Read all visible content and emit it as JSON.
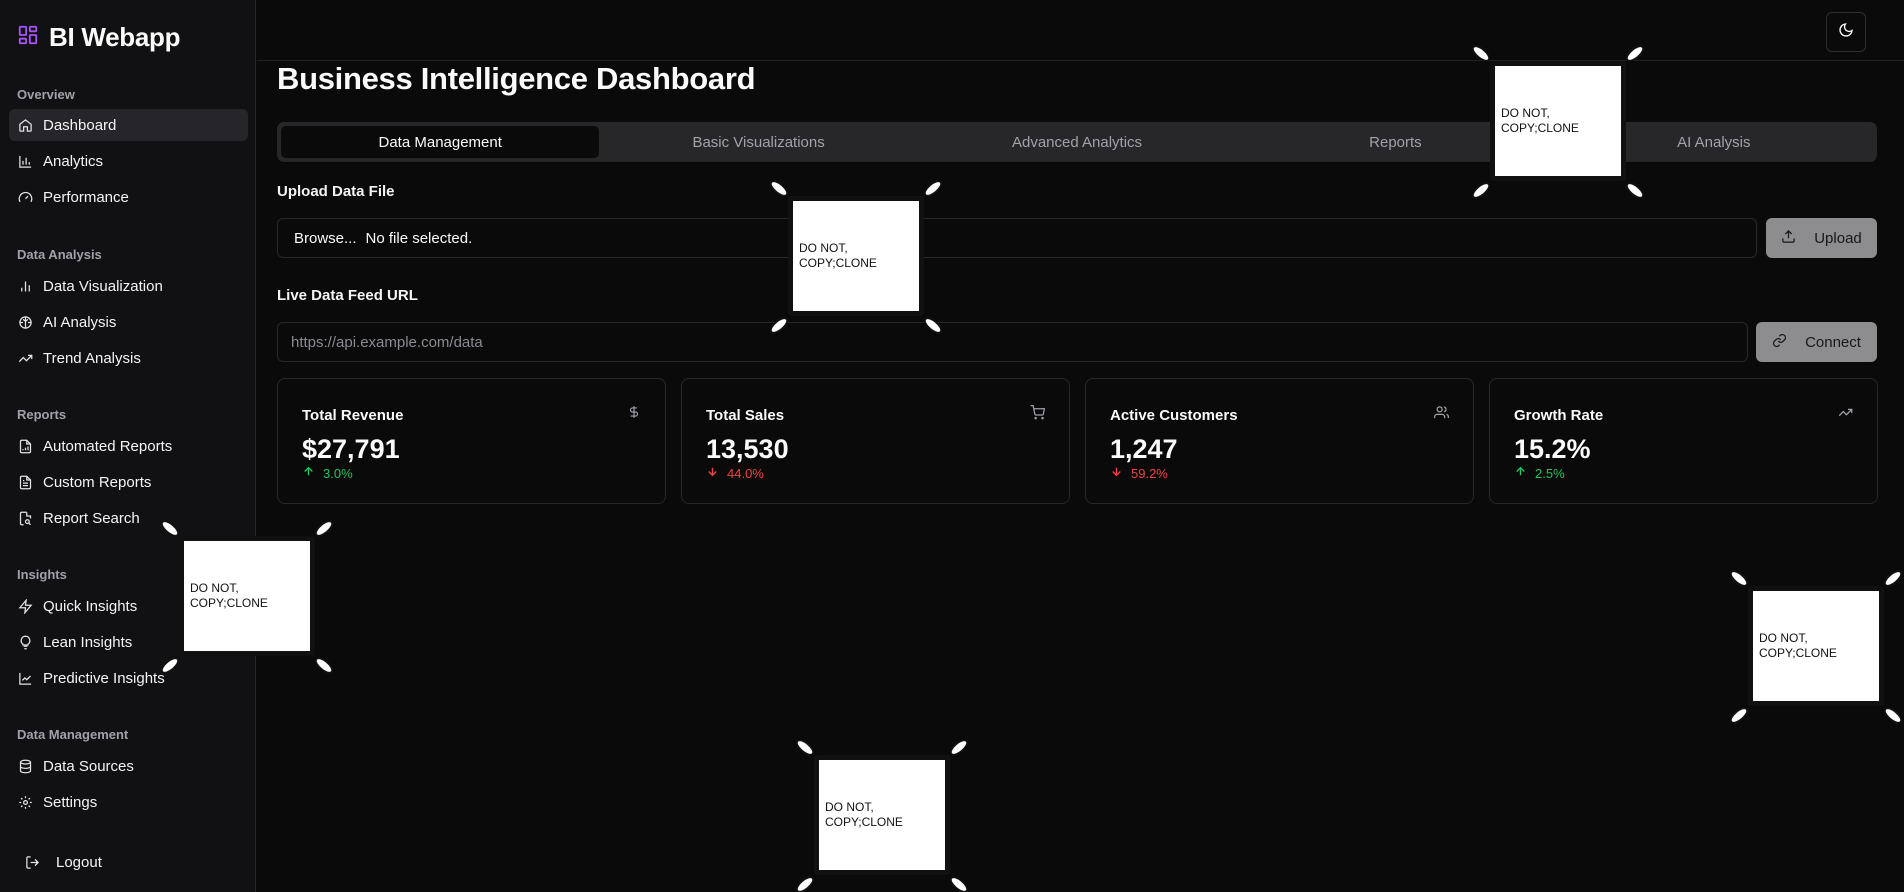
{
  "sidebar": {
    "brand": "BI Webapp",
    "sections": [
      {
        "title": "Overview",
        "items": [
          {
            "label": "Dashboard",
            "icon": "home-icon",
            "active": true
          },
          {
            "label": "Analytics",
            "icon": "bar-chart-icon"
          },
          {
            "label": "Performance",
            "icon": "gauge-icon"
          }
        ]
      },
      {
        "title": "Data Analysis",
        "items": [
          {
            "label": "Data Visualization",
            "icon": "bar-chart-2-icon"
          },
          {
            "label": "AI Analysis",
            "icon": "brain-icon"
          },
          {
            "label": "Trend Analysis",
            "icon": "trending-up-icon"
          }
        ]
      },
      {
        "title": "Reports",
        "items": [
          {
            "label": "Automated Reports",
            "icon": "file-chart-icon"
          },
          {
            "label": "Custom Reports",
            "icon": "file-text-icon"
          },
          {
            "label": "Report Search",
            "icon": "file-search-icon"
          }
        ]
      },
      {
        "title": "Insights",
        "items": [
          {
            "label": "Quick Insights",
            "icon": "zap-icon"
          },
          {
            "label": "Lean Insights",
            "icon": "lightbulb-icon"
          },
          {
            "label": "Predictive Insights",
            "icon": "line-chart-icon"
          }
        ]
      },
      {
        "title": "Data Management",
        "items": [
          {
            "label": "Data Sources",
            "icon": "database-icon"
          },
          {
            "label": "Settings",
            "icon": "gear-icon"
          }
        ]
      }
    ],
    "logout": "Logout"
  },
  "header": {
    "theme_toggle_icon": "moon-icon"
  },
  "main": {
    "title": "Business Intelligence Dashboard",
    "tabs": [
      {
        "label": "Data Management",
        "active": true
      },
      {
        "label": "Basic Visualizations"
      },
      {
        "label": "Advanced Analytics"
      },
      {
        "label": "Reports"
      },
      {
        "label": "AI Analysis"
      }
    ],
    "upload": {
      "label": "Upload Data File",
      "browse": "Browse...",
      "file_status": "No file selected.",
      "button": "Upload"
    },
    "feed": {
      "label": "Live Data Feed URL",
      "placeholder": "https://api.example.com/data",
      "button": "Connect"
    },
    "stats": [
      {
        "title": "Total Revenue",
        "value": "$27,791",
        "change": "3.0%",
        "direction": "up",
        "icon": "dollar-icon"
      },
      {
        "title": "Total Sales",
        "value": "13,530",
        "change": "44.0%",
        "direction": "down",
        "icon": "cart-icon"
      },
      {
        "title": "Active Customers",
        "value": "1,247",
        "change": "59.2%",
        "direction": "down",
        "icon": "users-icon"
      },
      {
        "title": "Growth Rate",
        "value": "15.2%",
        "change": "2.5%",
        "direction": "up",
        "icon": "trending-up-icon"
      }
    ]
  },
  "stickers": [
    {
      "text": "DO NOT, COPY;CLONE"
    },
    {
      "text": "DO NOT, COPY;CLONE"
    },
    {
      "text": "DO NOT, COPY;CLONE"
    },
    {
      "text": "DO NOT, COPY;CLONE"
    },
    {
      "text": "DO NOT, COPY;CLONE"
    }
  ],
  "colors": {
    "background": "#0a0a0b",
    "sidebar": "#111113",
    "brand_accent": "#a855f7",
    "positive": "#22c55e",
    "negative": "#ef4444"
  }
}
